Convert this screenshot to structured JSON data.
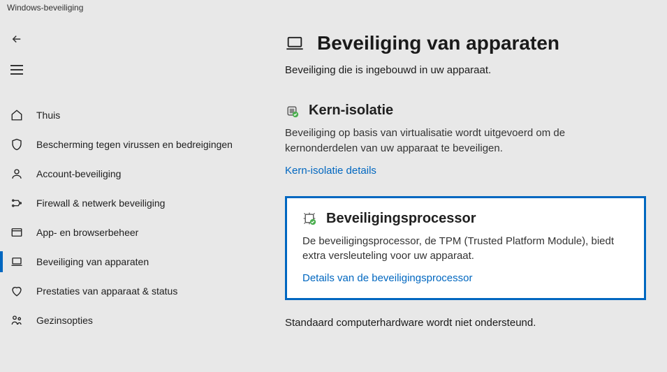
{
  "window_title": "Windows-beveiliging",
  "sidebar": {
    "items": [
      {
        "label": "Thuis"
      },
      {
        "label": "Bescherming tegen virussen en bedreigingen"
      },
      {
        "label": "Account-beveiliging"
      },
      {
        "label": "Firewall & netwerk beveiliging"
      },
      {
        "label": "App- en browserbeheer"
      },
      {
        "label": "Beveiliging van apparaten"
      },
      {
        "label": "Prestaties van apparaat & status"
      },
      {
        "label": "Gezinsopties"
      }
    ]
  },
  "page": {
    "title": "Beveiliging van apparaten",
    "subtitle": "Beveiliging die is ingebouwd in uw apparaat."
  },
  "sections": {
    "core_isolation": {
      "title": "Kern-isolatie",
      "desc": "Beveiliging op basis van virtualisatie wordt uitgevoerd om de kernonderdelen van uw apparaat te beveiligen.",
      "link": "Kern-isolatie details"
    },
    "security_processor": {
      "title": "Beveiligingsprocessor",
      "desc": "De beveiligingsprocessor, de TPM (Trusted Platform Module), biedt extra versleuteling voor uw apparaat.",
      "link": "Details van de beveiligingsprocessor"
    }
  },
  "footer": "Standaard computerhardware wordt niet ondersteund."
}
